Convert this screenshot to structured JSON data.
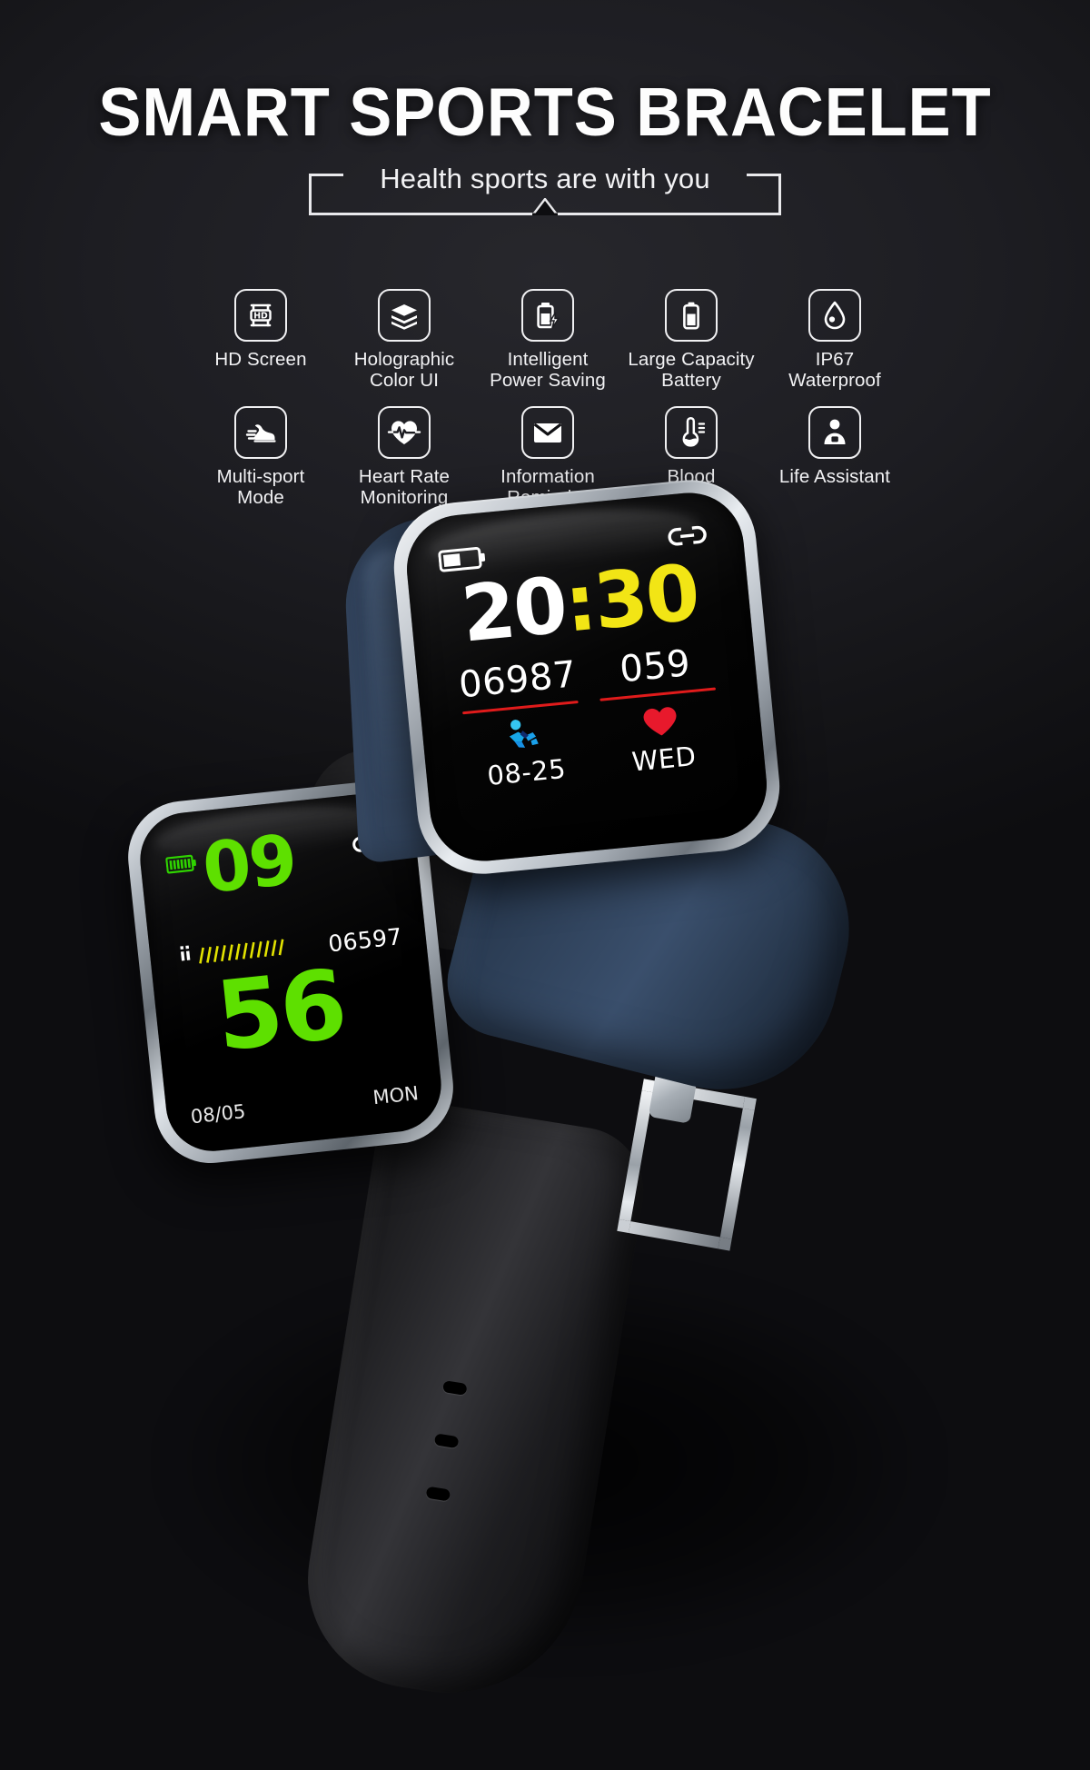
{
  "header": {
    "title": "SMART SPORTS BRACELET",
    "subtitle": "Health sports are with you"
  },
  "features": {
    "row1": [
      {
        "icon": "hd-screen-icon",
        "label": "HD Screen"
      },
      {
        "icon": "layers-icon",
        "label": "Holographic\nColor UI"
      },
      {
        "icon": "battery-charging-icon",
        "label": "Intelligent\nPower Saving"
      },
      {
        "icon": "battery-full-icon",
        "label": "Large Capacity\nBattery"
      },
      {
        "icon": "water-drop-icon",
        "label": "IP67\nWaterproof"
      }
    ],
    "row2": [
      {
        "icon": "running-shoe-icon",
        "label": "Multi-sport\nMode"
      },
      {
        "icon": "heart-pulse-icon",
        "label": "Heart Rate\nMonitoring"
      },
      {
        "icon": "envelope-icon",
        "label": "Information\nReminder"
      },
      {
        "icon": "thermometer-icon",
        "label": "Blood\nPressure"
      },
      {
        "icon": "person-assist-icon",
        "label": "Life Assistant"
      }
    ]
  },
  "watch_upper": {
    "battery_icon": "battery-half-icon",
    "link_icon": "bluetooth-link-icon",
    "time_hours": "20",
    "time_colon": ":",
    "time_minutes": "30",
    "steps": "06987",
    "heart_rate": "059",
    "activity_icon": "runner-icon",
    "date": "08-25",
    "heart_icon": "heart-icon",
    "weekday": "WED",
    "colors": {
      "hours": "#ffffff",
      "minutes": "#f2e515",
      "rule": "#e01b1b",
      "runner": "#1fb6ef",
      "heart": "#e8192c"
    }
  },
  "watch_lower": {
    "battery_icon": "battery-bars-icon",
    "link_icon": "bluetooth-link-icon",
    "hours": "09",
    "minutes": "56",
    "steps": "06597",
    "date": "08/05",
    "weekday": "MON",
    "colors": {
      "digits": "#5ee000",
      "battery": "#2fd400"
    }
  }
}
